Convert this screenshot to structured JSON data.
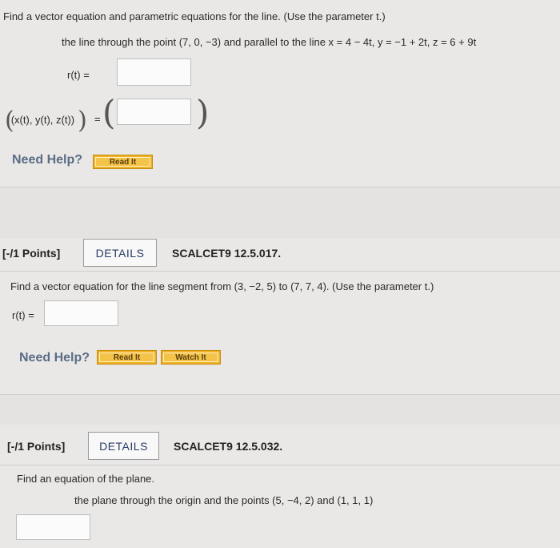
{
  "q1": {
    "prompt": "Find a vector equation and parametric equations for the line. (Use the parameter t.)",
    "subprompt": "the line through the point (7, 0, −3) and parallel to the line x = 4 − 4t, y = −1 + 2t, z = 6 + 9t",
    "r_label": "r(t)  =",
    "param_label": "(x(t), y(t), z(t))",
    "equals": "=",
    "need_help": "Need Help?",
    "read_it": "Read It"
  },
  "q2": {
    "points": "[-/1 Points]",
    "details": "DETAILS",
    "code": "SCALCET9 12.5.017.",
    "prompt": "Find a vector equation for the line segment from (3, −2, 5) to (7, 7, 4). (Use the parameter t.)",
    "r_label": "r(t)  =",
    "need_help": "Need Help?",
    "read_it": "Read It",
    "watch_it": "Watch It"
  },
  "q3": {
    "points": "[-/1 Points]",
    "details": "DETAILS",
    "code": "SCALCET9 12.5.032.",
    "prompt": "Find an equation of the plane.",
    "subprompt": "the plane through the origin and the points (5, −4, 2) and (1, 1, 1)"
  }
}
